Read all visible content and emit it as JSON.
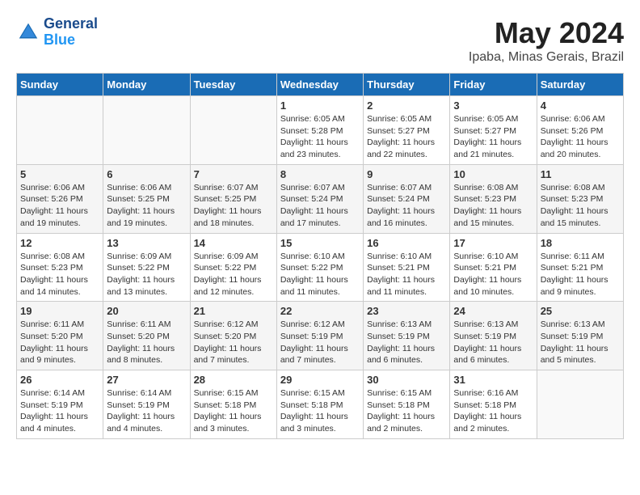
{
  "header": {
    "logo_line1": "General",
    "logo_line2": "Blue",
    "month_year": "May 2024",
    "location": "Ipaba, Minas Gerais, Brazil"
  },
  "days_of_week": [
    "Sunday",
    "Monday",
    "Tuesday",
    "Wednesday",
    "Thursday",
    "Friday",
    "Saturday"
  ],
  "weeks": [
    [
      {
        "day": "",
        "info": ""
      },
      {
        "day": "",
        "info": ""
      },
      {
        "day": "",
        "info": ""
      },
      {
        "day": "1",
        "info": "Sunrise: 6:05 AM\nSunset: 5:28 PM\nDaylight: 11 hours\nand 23 minutes."
      },
      {
        "day": "2",
        "info": "Sunrise: 6:05 AM\nSunset: 5:27 PM\nDaylight: 11 hours\nand 22 minutes."
      },
      {
        "day": "3",
        "info": "Sunrise: 6:05 AM\nSunset: 5:27 PM\nDaylight: 11 hours\nand 21 minutes."
      },
      {
        "day": "4",
        "info": "Sunrise: 6:06 AM\nSunset: 5:26 PM\nDaylight: 11 hours\nand 20 minutes."
      }
    ],
    [
      {
        "day": "5",
        "info": "Sunrise: 6:06 AM\nSunset: 5:26 PM\nDaylight: 11 hours\nand 19 minutes."
      },
      {
        "day": "6",
        "info": "Sunrise: 6:06 AM\nSunset: 5:25 PM\nDaylight: 11 hours\nand 19 minutes."
      },
      {
        "day": "7",
        "info": "Sunrise: 6:07 AM\nSunset: 5:25 PM\nDaylight: 11 hours\nand 18 minutes."
      },
      {
        "day": "8",
        "info": "Sunrise: 6:07 AM\nSunset: 5:24 PM\nDaylight: 11 hours\nand 17 minutes."
      },
      {
        "day": "9",
        "info": "Sunrise: 6:07 AM\nSunset: 5:24 PM\nDaylight: 11 hours\nand 16 minutes."
      },
      {
        "day": "10",
        "info": "Sunrise: 6:08 AM\nSunset: 5:23 PM\nDaylight: 11 hours\nand 15 minutes."
      },
      {
        "day": "11",
        "info": "Sunrise: 6:08 AM\nSunset: 5:23 PM\nDaylight: 11 hours\nand 15 minutes."
      }
    ],
    [
      {
        "day": "12",
        "info": "Sunrise: 6:08 AM\nSunset: 5:23 PM\nDaylight: 11 hours\nand 14 minutes."
      },
      {
        "day": "13",
        "info": "Sunrise: 6:09 AM\nSunset: 5:22 PM\nDaylight: 11 hours\nand 13 minutes."
      },
      {
        "day": "14",
        "info": "Sunrise: 6:09 AM\nSunset: 5:22 PM\nDaylight: 11 hours\nand 12 minutes."
      },
      {
        "day": "15",
        "info": "Sunrise: 6:10 AM\nSunset: 5:22 PM\nDaylight: 11 hours\nand 11 minutes."
      },
      {
        "day": "16",
        "info": "Sunrise: 6:10 AM\nSunset: 5:21 PM\nDaylight: 11 hours\nand 11 minutes."
      },
      {
        "day": "17",
        "info": "Sunrise: 6:10 AM\nSunset: 5:21 PM\nDaylight: 11 hours\nand 10 minutes."
      },
      {
        "day": "18",
        "info": "Sunrise: 6:11 AM\nSunset: 5:21 PM\nDaylight: 11 hours\nand 9 minutes."
      }
    ],
    [
      {
        "day": "19",
        "info": "Sunrise: 6:11 AM\nSunset: 5:20 PM\nDaylight: 11 hours\nand 9 minutes."
      },
      {
        "day": "20",
        "info": "Sunrise: 6:11 AM\nSunset: 5:20 PM\nDaylight: 11 hours\nand 8 minutes."
      },
      {
        "day": "21",
        "info": "Sunrise: 6:12 AM\nSunset: 5:20 PM\nDaylight: 11 hours\nand 7 minutes."
      },
      {
        "day": "22",
        "info": "Sunrise: 6:12 AM\nSunset: 5:19 PM\nDaylight: 11 hours\nand 7 minutes."
      },
      {
        "day": "23",
        "info": "Sunrise: 6:13 AM\nSunset: 5:19 PM\nDaylight: 11 hours\nand 6 minutes."
      },
      {
        "day": "24",
        "info": "Sunrise: 6:13 AM\nSunset: 5:19 PM\nDaylight: 11 hours\nand 6 minutes."
      },
      {
        "day": "25",
        "info": "Sunrise: 6:13 AM\nSunset: 5:19 PM\nDaylight: 11 hours\nand 5 minutes."
      }
    ],
    [
      {
        "day": "26",
        "info": "Sunrise: 6:14 AM\nSunset: 5:19 PM\nDaylight: 11 hours\nand 4 minutes."
      },
      {
        "day": "27",
        "info": "Sunrise: 6:14 AM\nSunset: 5:19 PM\nDaylight: 11 hours\nand 4 minutes."
      },
      {
        "day": "28",
        "info": "Sunrise: 6:15 AM\nSunset: 5:18 PM\nDaylight: 11 hours\nand 3 minutes."
      },
      {
        "day": "29",
        "info": "Sunrise: 6:15 AM\nSunset: 5:18 PM\nDaylight: 11 hours\nand 3 minutes."
      },
      {
        "day": "30",
        "info": "Sunrise: 6:15 AM\nSunset: 5:18 PM\nDaylight: 11 hours\nand 2 minutes."
      },
      {
        "day": "31",
        "info": "Sunrise: 6:16 AM\nSunset: 5:18 PM\nDaylight: 11 hours\nand 2 minutes."
      },
      {
        "day": "",
        "info": ""
      }
    ]
  ]
}
